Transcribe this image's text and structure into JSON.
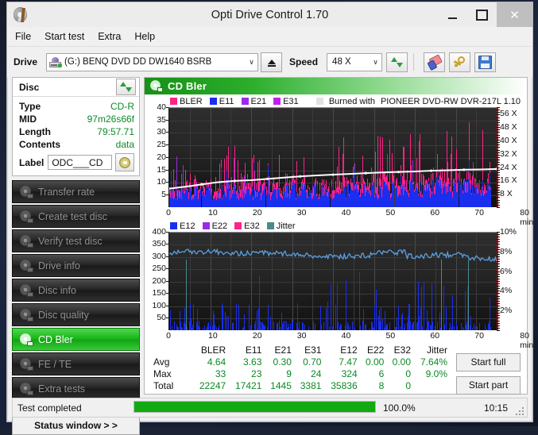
{
  "window": {
    "title": "Opti Drive Control 1.70",
    "app_icon": "disc-icon",
    "minimize": "–",
    "maximize": "▢",
    "close": "✕"
  },
  "menu": {
    "items": [
      "File",
      "Start test",
      "Extra",
      "Help"
    ]
  },
  "toolbar": {
    "drive_label": "Drive",
    "drive_value": "(G:)   BENQ DVD DD DW1640 BSRB",
    "drive_icon": "optical-drive-icon",
    "eject_icon": "eject-icon",
    "speed_label": "Speed",
    "speed_value": "48 X",
    "refresh_icon": "refresh-icon",
    "eraser_icon": "eraser-icon",
    "key_icon": "key-icon",
    "save_icon": "save-icon",
    "dropdown_arrow": "∨"
  },
  "disc_panel": {
    "title": "Disc",
    "refresh_icon": "refresh-icon",
    "rows": [
      {
        "key": "Type",
        "value": "CD-R"
      },
      {
        "key": "MID",
        "value": "97m26s66f"
      },
      {
        "key": "Length",
        "value": "79:57.71"
      },
      {
        "key": "Contents",
        "value": "data"
      }
    ],
    "label_key": "Label",
    "label_value": "ODC___CD",
    "label_button_icon": "cd-icon"
  },
  "sidebar": {
    "items": [
      {
        "label": "Transfer rate",
        "icon": "disc-icon",
        "active": false
      },
      {
        "label": "Create test disc",
        "icon": "disc-icon",
        "active": false
      },
      {
        "label": "Verify test disc",
        "icon": "disc-icon",
        "active": false
      },
      {
        "label": "Drive info",
        "icon": "disc-icon",
        "active": false
      },
      {
        "label": "Disc info",
        "icon": "disc-icon",
        "active": false
      },
      {
        "label": "Disc quality",
        "icon": "disc-icon",
        "active": false
      },
      {
        "label": "CD Bler",
        "icon": "disc-icon",
        "active": true
      },
      {
        "label": "FE / TE",
        "icon": "disc-icon",
        "active": false
      },
      {
        "label": "Extra tests",
        "icon": "disc-icon",
        "active": false
      }
    ],
    "status_window_button": "Status window > >"
  },
  "content": {
    "header_title": "CD Bler",
    "header_icon": "disc-icon"
  },
  "chart_data": [
    {
      "type": "bar",
      "id": "bler-chart",
      "title": "",
      "legend": [
        {
          "name": "BLER",
          "color": "#ff2288"
        },
        {
          "name": "E11",
          "color": "#1a2ef0"
        },
        {
          "name": "E21",
          "color": "#9a2ae8"
        },
        {
          "name": "E31",
          "color": "#c020f0"
        }
      ],
      "burned_with_label": "Burned with",
      "burned_with_value": "PIONEER DVD-RW DVR-217L 1.10",
      "burned_with_swatch": "#e2e2e2",
      "xlabel": "min",
      "x_ticks": [
        0,
        10,
        20,
        30,
        40,
        50,
        60,
        70,
        80
      ],
      "xlim": [
        0,
        80
      ],
      "y_ticks": [
        5,
        10,
        15,
        20,
        25,
        30,
        35,
        40
      ],
      "ylim": [
        0,
        40
      ],
      "right_axis_ticks": [
        "8 X",
        "16 X",
        "24 X",
        "32 X",
        "40 X",
        "48 X",
        "56 X"
      ],
      "right_axis_values": [
        8,
        16,
        24,
        32,
        40,
        48,
        56
      ],
      "right_ylim": [
        0,
        60
      ],
      "speed_curve_color": "#ffffff",
      "speed_curve_points": [
        [
          0,
          7.5
        ],
        [
          4,
          8.3
        ],
        [
          8,
          9.2
        ],
        [
          12,
          10.1
        ],
        [
          16,
          10.6
        ],
        [
          20,
          10.9
        ],
        [
          24,
          11.4
        ],
        [
          28,
          11.9
        ],
        [
          32,
          12.4
        ],
        [
          36,
          12.8
        ],
        [
          40,
          13.1
        ],
        [
          44,
          13.4
        ],
        [
          48,
          13.7
        ],
        [
          52,
          14.0
        ],
        [
          56,
          14.2
        ],
        [
          60,
          14.4
        ],
        [
          64,
          14.7
        ],
        [
          68,
          14.9
        ],
        [
          72,
          15.1
        ],
        [
          76,
          15.2
        ],
        [
          80,
          15.4
        ]
      ],
      "grid": true
    },
    {
      "type": "bar",
      "id": "e12-chart",
      "title": "",
      "legend": [
        {
          "name": "E12",
          "color": "#1a2ef0"
        },
        {
          "name": "E22",
          "color": "#9a2ae8"
        },
        {
          "name": "E32",
          "color": "#ff2288"
        },
        {
          "name": "Jitter",
          "color": "#4a8a8a"
        }
      ],
      "xlabel": "min",
      "x_ticks": [
        0,
        10,
        20,
        30,
        40,
        50,
        60,
        70,
        80
      ],
      "xlim": [
        0,
        80
      ],
      "y_ticks": [
        50,
        100,
        150,
        200,
        250,
        300,
        350,
        400
      ],
      "ylim": [
        0,
        400
      ],
      "right_axis_ticks": [
        "2%",
        "4%",
        "6%",
        "8%",
        "10%"
      ],
      "right_axis_values": [
        2,
        4,
        6,
        8,
        10
      ],
      "right_ylim": [
        0,
        10
      ],
      "jitter_color": "#5a9fe0",
      "jitter_mean_pct": 7.64,
      "grid": true
    }
  ],
  "stats": {
    "columns": [
      "BLER",
      "E11",
      "E21",
      "E31",
      "E12",
      "E22",
      "E32",
      "Jitter"
    ],
    "rows": [
      {
        "label": "Avg",
        "values": [
          "4.64",
          "3.63",
          "0.30",
          "0.70",
          "7.47",
          "0.00",
          "0.00",
          "7.64%"
        ]
      },
      {
        "label": "Max",
        "values": [
          "33",
          "23",
          "9",
          "24",
          "324",
          "6",
          "0",
          "9.0%"
        ]
      },
      {
        "label": "Total",
        "values": [
          "22247",
          "17421",
          "1445",
          "3381",
          "35836",
          "8",
          "0",
          ""
        ]
      }
    ]
  },
  "actions": {
    "start_full": "Start full",
    "start_part": "Start part"
  },
  "statusbar": {
    "status_text": "Test completed",
    "progress_pct": "100.0%",
    "progress_value": 100,
    "clock": "10:15"
  }
}
